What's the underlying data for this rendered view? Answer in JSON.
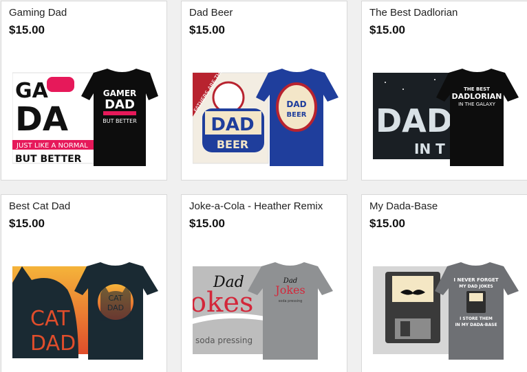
{
  "products": [
    {
      "title": "Gaming Dad",
      "price": "$15.00",
      "shirt_color": "#0d0d0d",
      "print": {
        "line1": "GAMER",
        "line2": "DAD",
        "line3": "BUT BETTER",
        "accent": "#e6195a"
      },
      "poster": {
        "text_top": "GA",
        "text_big": "DA",
        "sub1": "JUST LIKE A NORMAL",
        "sub2": "BUT BETTER"
      }
    },
    {
      "title": "Dad Beer",
      "price": "$15.00",
      "shirt_color": "#1f3e9c",
      "print": {
        "line1": "DAD",
        "line2": "BEER"
      },
      "poster": {
        "text_top": "DAD",
        "text_big": "BEER",
        "side": "FATHERS ARE THE FIRST"
      }
    },
    {
      "title": "The Best Dadlorian",
      "price": "$15.00",
      "shirt_color": "#0d0d0d",
      "print": {
        "line0": "THE BEST",
        "line1": "DADLORIAN",
        "line2": "IN THE GALAXY"
      },
      "poster": {
        "text_big": "DADL",
        "sub1": "IN T"
      }
    },
    {
      "title": "Best Cat Dad",
      "price": "$15.00",
      "shirt_color": "#1a2a33",
      "print": {
        "line1": "CAT",
        "line2": "DAD"
      },
      "poster": {
        "text_top": "CAT",
        "text_big": "DAD"
      }
    },
    {
      "title": "Joke-a-Cola - Heather Remix",
      "price": "$15.00",
      "shirt_color": "#8f9193",
      "print": {
        "line1": "Dad",
        "line2": "Jokes",
        "line3": "soda pressing"
      },
      "poster": {
        "text_top": "Dad",
        "text_big": "okes",
        "sub1": "soda pressing"
      }
    },
    {
      "title": "My Dada-Base",
      "price": "$15.00",
      "shirt_color": "#6e7074",
      "print": {
        "line1": "I NEVER FORGET",
        "line2": "MY DAD JOKES",
        "line3": "I STORE THEM",
        "line4": "IN MY DADA-BASE"
      },
      "poster": {}
    }
  ]
}
